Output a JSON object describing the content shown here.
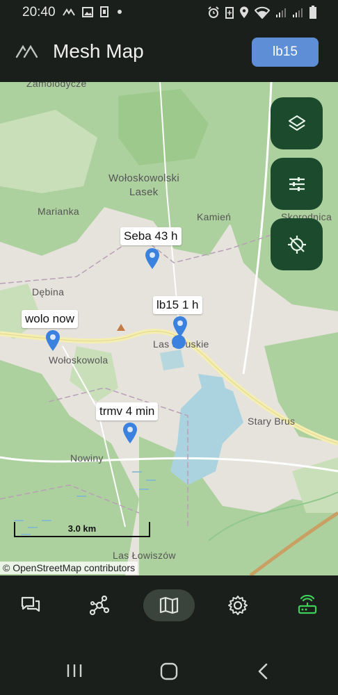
{
  "status_bar": {
    "time": "20:40",
    "left_icons": [
      "cast-icon",
      "image-icon",
      "sim-icon",
      "dot-icon"
    ],
    "right_icons": [
      "alarm-icon",
      "battery-saver-icon",
      "location-icon",
      "wifi-icon",
      "signal-icon",
      "signal-icon",
      "battery-icon"
    ]
  },
  "app_bar": {
    "title": "Mesh Map",
    "node_button_label": "lb15"
  },
  "map": {
    "fabs": [
      "layers-icon",
      "tune-icon",
      "location-disabled-icon"
    ],
    "pins": [
      {
        "label": "Seba 43 h"
      },
      {
        "label": "lb15 1 h"
      },
      {
        "label": "wolo now"
      },
      {
        "label": "trmv 4 min"
      }
    ],
    "place_names": [
      "Zamolodycze",
      "Wołoskowolski",
      "Lasek",
      "Marianka",
      "Kamień",
      "Skorodnica",
      "Dębina",
      "Wołoskowola",
      "Las Struskie",
      "Stary Brus",
      "Nowiny",
      "Las Łowiszów"
    ],
    "scale_label": "3.0 km",
    "attribution": "© OpenStreetMap contributors"
  },
  "bottom_nav": {
    "items": [
      "messages-icon",
      "nodes-icon",
      "map-icon",
      "settings-icon",
      "connection-icon"
    ],
    "active": "map-icon"
  },
  "system_nav": [
    "recents-icon",
    "home-icon",
    "back-icon"
  ],
  "colors": {
    "accent": "#5e8fd6",
    "fab": "#1b4a2c",
    "connected": "#3ecf5a"
  }
}
